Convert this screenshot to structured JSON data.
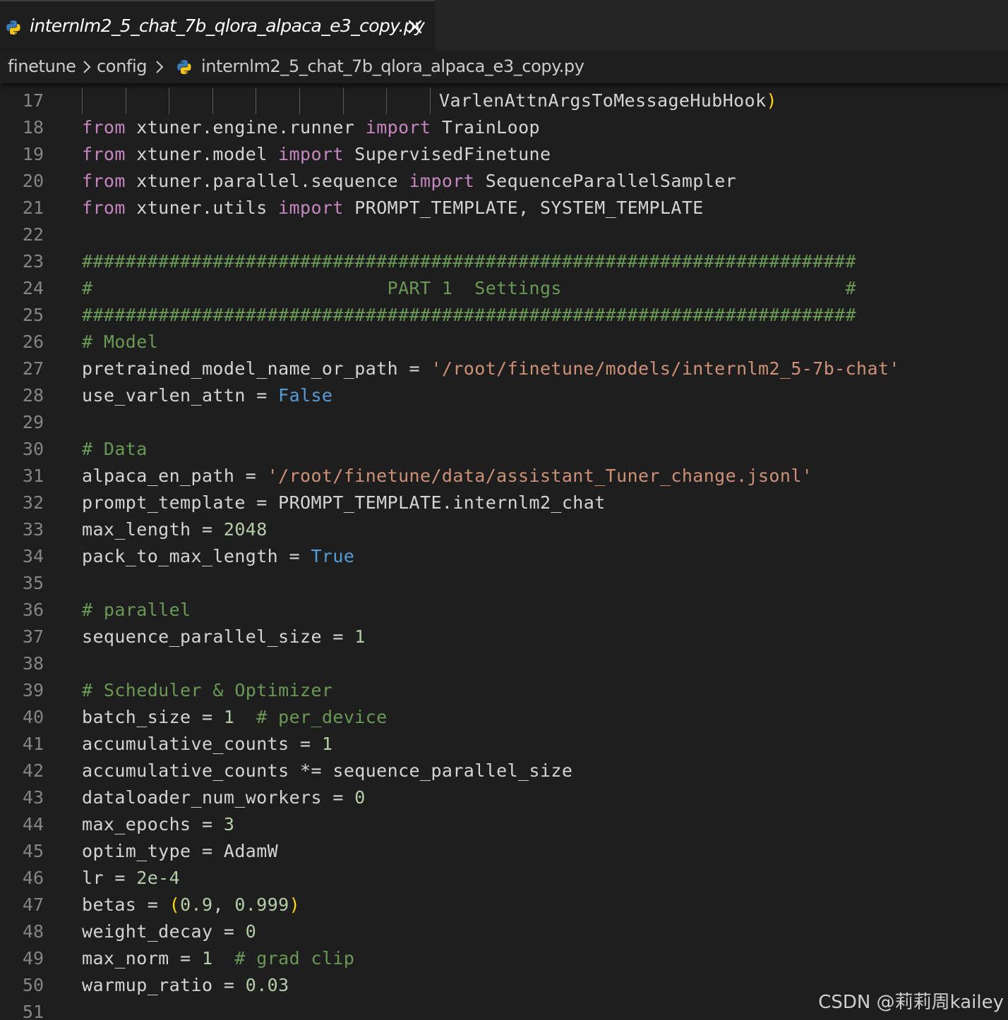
{
  "tab": {
    "filename": "internlm2_5_chat_7b_qlora_alpaca_e3_copy.py",
    "icon": "python-icon",
    "close_icon": "close-icon"
  },
  "breadcrumb": [
    {
      "label": "finetune",
      "kind": "folder"
    },
    {
      "label": "config",
      "kind": "folder"
    },
    {
      "label": "internlm2_5_chat_7b_qlora_alpaca_e3_copy.py",
      "kind": "file",
      "icon": "python-icon"
    }
  ],
  "colors": {
    "background": "#1e1e1e",
    "tabbar": "#252526",
    "keyword": "#c586c0",
    "comment": "#6a9955",
    "string": "#ce9178",
    "number": "#b5cea8",
    "constant": "#569cd6",
    "bracket": "#ffd700",
    "text": "#d4d4d4",
    "line_number": "#858585"
  },
  "code_lines": [
    {
      "n": "17",
      "tokens": [
        [
          "VarlenAttnArgsToMessageHubHook",
          "text"
        ],
        [
          ")",
          "bracket"
        ]
      ]
    },
    {
      "n": "18",
      "tokens": [
        [
          "from",
          "keyword"
        ],
        [
          " xtuner.engine.runner ",
          "text"
        ],
        [
          "import",
          "keyword"
        ],
        [
          " TrainLoop",
          "text"
        ]
      ]
    },
    {
      "n": "19",
      "tokens": [
        [
          "from",
          "keyword"
        ],
        [
          " xtuner.model ",
          "text"
        ],
        [
          "import",
          "keyword"
        ],
        [
          " SupervisedFinetune",
          "text"
        ]
      ]
    },
    {
      "n": "20",
      "tokens": [
        [
          "from",
          "keyword"
        ],
        [
          " xtuner.parallel.sequence ",
          "text"
        ],
        [
          "import",
          "keyword"
        ],
        [
          " SequenceParallelSampler",
          "text"
        ]
      ]
    },
    {
      "n": "21",
      "tokens": [
        [
          "from",
          "keyword"
        ],
        [
          " xtuner.utils ",
          "text"
        ],
        [
          "import",
          "keyword"
        ],
        [
          " PROMPT_TEMPLATE, SYSTEM_TEMPLATE",
          "text"
        ]
      ]
    },
    {
      "n": "22",
      "tokens": []
    },
    {
      "n": "23",
      "tokens": [
        [
          "#######################################################################",
          "comment"
        ]
      ]
    },
    {
      "n": "24",
      "tokens": [
        [
          "#                           PART 1  Settings                          #",
          "comment"
        ]
      ]
    },
    {
      "n": "25",
      "tokens": [
        [
          "#######################################################################",
          "comment"
        ]
      ]
    },
    {
      "n": "26",
      "tokens": [
        [
          "# Model",
          "comment"
        ]
      ]
    },
    {
      "n": "27",
      "tokens": [
        [
          "pretrained_model_name_or_path = ",
          "text"
        ],
        [
          "'/root/finetune/models/internlm2_5-7b-chat'",
          "string"
        ]
      ]
    },
    {
      "n": "28",
      "tokens": [
        [
          "use_varlen_attn = ",
          "text"
        ],
        [
          "False",
          "const"
        ]
      ]
    },
    {
      "n": "29",
      "tokens": []
    },
    {
      "n": "30",
      "tokens": [
        [
          "# Data",
          "comment"
        ]
      ]
    },
    {
      "n": "31",
      "tokens": [
        [
          "alpaca_en_path = ",
          "text"
        ],
        [
          "'/root/finetune/data/assistant_Tuner_change.jsonl'",
          "string"
        ]
      ]
    },
    {
      "n": "32",
      "tokens": [
        [
          "prompt_template = PROMPT_TEMPLATE.internlm2_chat",
          "text"
        ]
      ]
    },
    {
      "n": "33",
      "tokens": [
        [
          "max_length = ",
          "text"
        ],
        [
          "2048",
          "number"
        ]
      ]
    },
    {
      "n": "34",
      "tokens": [
        [
          "pack_to_max_length = ",
          "text"
        ],
        [
          "True",
          "const"
        ]
      ]
    },
    {
      "n": "35",
      "tokens": []
    },
    {
      "n": "36",
      "tokens": [
        [
          "# parallel",
          "comment"
        ]
      ]
    },
    {
      "n": "37",
      "tokens": [
        [
          "sequence_parallel_size = ",
          "text"
        ],
        [
          "1",
          "number"
        ]
      ]
    },
    {
      "n": "38",
      "tokens": []
    },
    {
      "n": "39",
      "tokens": [
        [
          "# Scheduler & Optimizer",
          "comment"
        ]
      ]
    },
    {
      "n": "40",
      "tokens": [
        [
          "batch_size = ",
          "text"
        ],
        [
          "1",
          "number"
        ],
        [
          "  ",
          "text"
        ],
        [
          "# per_device",
          "comment"
        ]
      ]
    },
    {
      "n": "41",
      "tokens": [
        [
          "accumulative_counts = ",
          "text"
        ],
        [
          "1",
          "number"
        ]
      ]
    },
    {
      "n": "42",
      "tokens": [
        [
          "accumulative_counts *= sequence_parallel_size",
          "text"
        ]
      ]
    },
    {
      "n": "43",
      "tokens": [
        [
          "dataloader_num_workers = ",
          "text"
        ],
        [
          "0",
          "number"
        ]
      ]
    },
    {
      "n": "44",
      "tokens": [
        [
          "max_epochs = ",
          "text"
        ],
        [
          "3",
          "number"
        ]
      ]
    },
    {
      "n": "45",
      "tokens": [
        [
          "optim_type = AdamW",
          "text"
        ]
      ]
    },
    {
      "n": "46",
      "tokens": [
        [
          "lr = ",
          "text"
        ],
        [
          "2e-4",
          "number"
        ]
      ]
    },
    {
      "n": "47",
      "tokens": [
        [
          "betas = ",
          "text"
        ],
        [
          "(",
          "bracket"
        ],
        [
          "0.9",
          "number"
        ],
        [
          ", ",
          "text"
        ],
        [
          "0.999",
          "number"
        ],
        [
          ")",
          "bracket"
        ]
      ]
    },
    {
      "n": "48",
      "tokens": [
        [
          "weight_decay = ",
          "text"
        ],
        [
          "0",
          "number"
        ]
      ]
    },
    {
      "n": "49",
      "tokens": [
        [
          "max_norm = ",
          "text"
        ],
        [
          "1",
          "number"
        ],
        [
          "  ",
          "text"
        ],
        [
          "# grad clip",
          "comment"
        ]
      ]
    },
    {
      "n": "50",
      "tokens": [
        [
          "warmup_ratio = ",
          "text"
        ],
        [
          "0.03",
          "number"
        ]
      ]
    },
    {
      "n": "51",
      "tokens": []
    }
  ],
  "watermark": "CSDN @莉莉周kailey"
}
